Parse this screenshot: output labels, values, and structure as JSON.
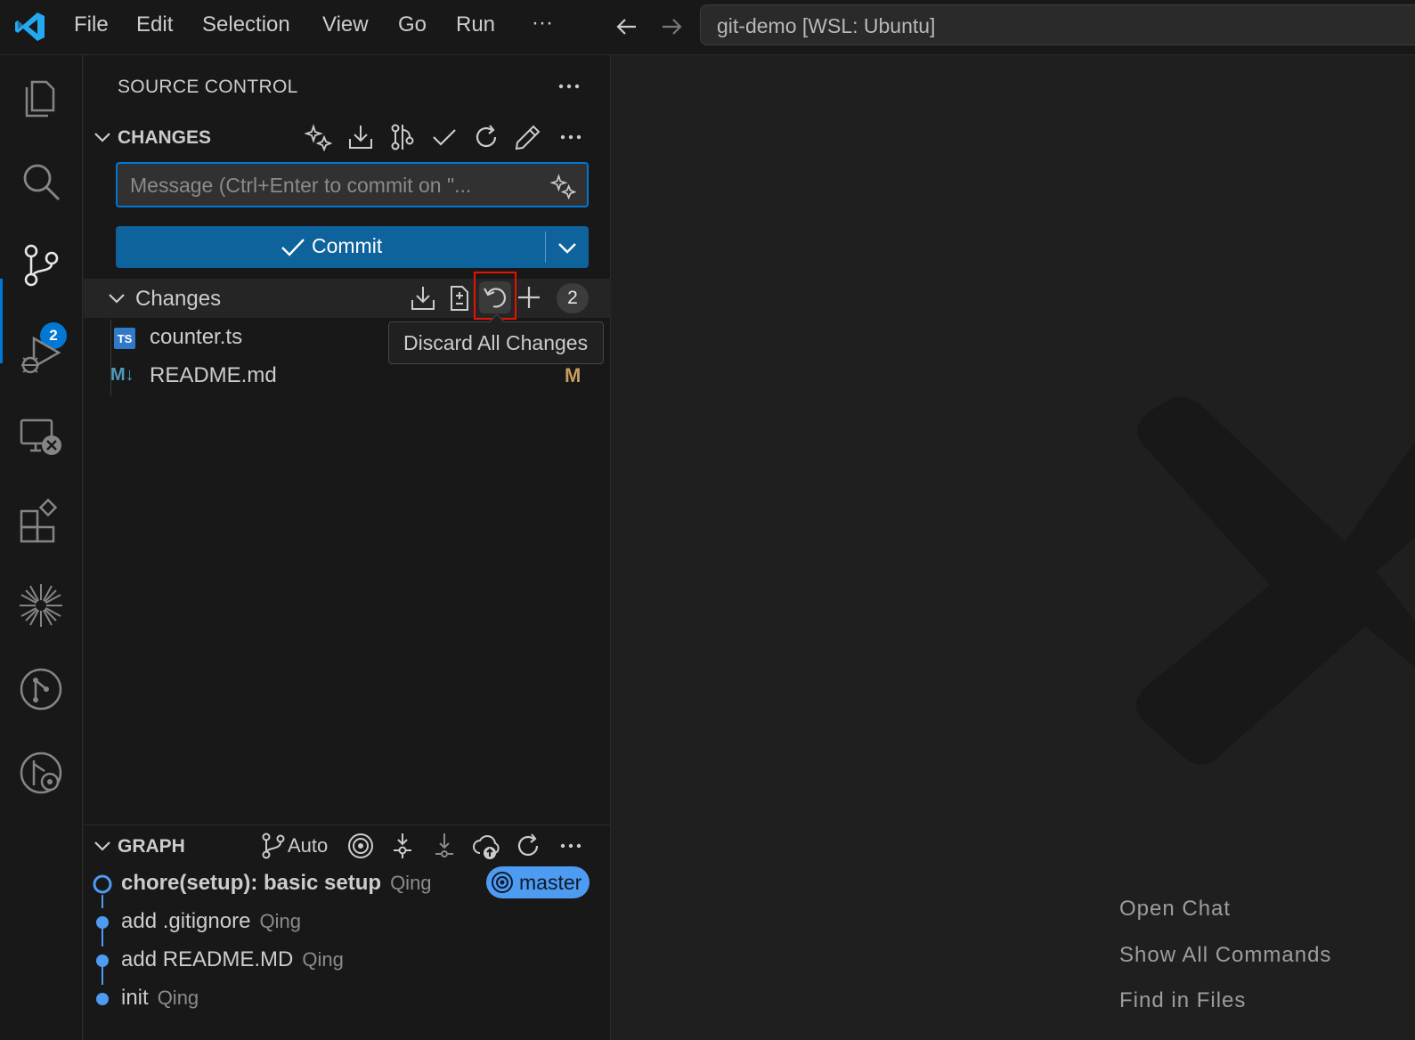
{
  "titlebar": {
    "menu": [
      "File",
      "Edit",
      "Selection",
      "View",
      "Go",
      "Run",
      "···"
    ],
    "search_text": "git-demo [WSL: Ubuntu]"
  },
  "activitybar": {
    "items": [
      "explorer-icon",
      "search-icon",
      "source-control-icon",
      "run-debug-icon",
      "remote-explorer-icon",
      "extensions-icon",
      "copilot-icon",
      "git-graph-icon",
      "git-history-icon"
    ],
    "scm_badge": "2"
  },
  "sidebar": {
    "title": "SOURCE CONTROL",
    "changes_section_title": "CHANGES",
    "message_placeholder": "Message (Ctrl+Enter to commit on \"...",
    "commit_label": "Commit",
    "changes_group_label": "Changes",
    "changes_count": "2",
    "files": [
      {
        "name": "counter.ts",
        "icon": "TS",
        "status": ""
      },
      {
        "name": "README.md",
        "icon": "M↓",
        "status": "M"
      }
    ],
    "tooltip": "Discard All Changes",
    "graph_title": "GRAPH",
    "graph_auto": "Auto",
    "commits": [
      {
        "message": "chore(setup): basic setup",
        "author": "Qing"
      },
      {
        "message": "add .gitignore",
        "author": "Qing"
      },
      {
        "message": "add README.MD",
        "author": "Qing"
      },
      {
        "message": "init",
        "author": "Qing"
      }
    ],
    "branch": "master"
  },
  "editor": {
    "hints": [
      "Open Chat",
      "Show All Commands",
      "Find in Files"
    ]
  },
  "colors": {
    "accent": "#0078d4",
    "commit_button": "#0e639c",
    "highlight": "#e51400",
    "graph_dot": "#4e9bf2",
    "modified": "#c69d5c"
  }
}
